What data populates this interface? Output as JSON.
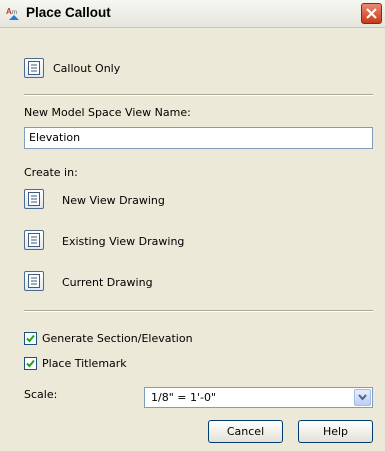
{
  "window": {
    "title": "Place Callout",
    "app_icon": "autocad-icon"
  },
  "callout_only": {
    "label": "Callout Only",
    "icon": "callout-icon"
  },
  "view_name": {
    "label": "New Model Space View Name:",
    "value": "Elevation"
  },
  "create_in": {
    "label": "Create in:",
    "options": [
      {
        "label": "New View Drawing",
        "icon": "new-view-drawing-icon"
      },
      {
        "label": "Existing View Drawing",
        "icon": "existing-view-drawing-icon"
      },
      {
        "label": "Current Drawing",
        "icon": "current-drawing-icon"
      }
    ]
  },
  "options": {
    "generate_section": {
      "label": "Generate Section/Elevation",
      "checked": true
    },
    "place_titlemark": {
      "label": "Place Titlemark",
      "checked": true
    }
  },
  "scale": {
    "label": "Scale:",
    "value": "1/8\" = 1'-0\""
  },
  "buttons": {
    "cancel": "Cancel",
    "help": "Help"
  },
  "colors": {
    "window_bg": "#ece9d8",
    "close_red": "#c6391a",
    "border_blue": "#7f9db9",
    "check_green": "#21a121"
  }
}
